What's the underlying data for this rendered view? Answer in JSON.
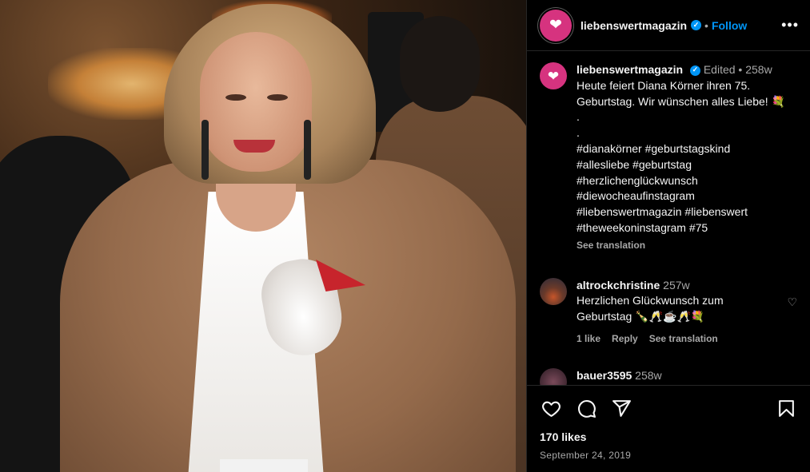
{
  "post": {
    "username": "liebenswertmagazin",
    "follow_label": "Follow",
    "more_label": "•••",
    "dot": "•",
    "edited_label": "Edited",
    "age": "258w",
    "caption_text": "Heute feiert Diana Körner ihren 75. Geburtstag. Wir wünschen alles Liebe! 💐\n.\n.\n#dianakörner #geburtstagskind\n#allesliebe #geburtstag\n#herzlichenglückwunsch\n#diewocheaufinstagram\n#liebenswertmagazin #liebenswert\n#theweekoninstagram #75",
    "see_translation": "See translation"
  },
  "comments": [
    {
      "username": "altrockchristine",
      "age": "257w",
      "text": "Herzlichen Glückwunsch zum Geburtstag 🍾🥂☕🥂💐",
      "likes": "1 like",
      "reply": "Reply",
      "see_translation": "See translation"
    },
    {
      "username": "bauer3595",
      "age": "258w"
    }
  ],
  "footer": {
    "likes": "170 likes",
    "date": "September 24, 2019"
  },
  "icons": {
    "heart": "heart-icon",
    "comment": "comment-icon",
    "share": "share-icon",
    "bookmark": "bookmark-icon"
  },
  "colors": {
    "accent": "#0095f6",
    "avatar_pink": "#d6337f",
    "background": "#000000",
    "muted_text": "#a8a8a8"
  }
}
